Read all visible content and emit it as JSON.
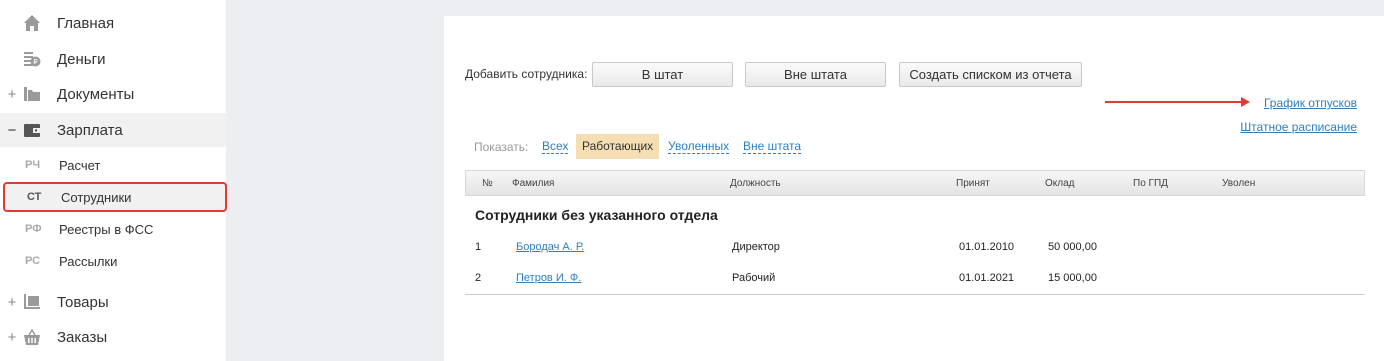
{
  "sidebar": {
    "items": [
      {
        "label": "Главная",
        "icon": "home-icon"
      },
      {
        "label": "Деньги",
        "icon": "money-icon"
      },
      {
        "label": "Документы",
        "icon": "folder-icon",
        "toggle": "+"
      },
      {
        "label": "Зарплата",
        "icon": "wallet-icon",
        "toggle": "−"
      },
      {
        "label": "Товары",
        "icon": "cart-icon",
        "toggle": "+"
      },
      {
        "label": "Заказы",
        "icon": "basket-icon",
        "toggle": "+"
      }
    ],
    "subitems": [
      {
        "abbr": "РЧ",
        "label": "Расчет"
      },
      {
        "abbr": "СТ",
        "label": "Сотрудники"
      },
      {
        "abbr": "РФ",
        "label": "Реестры в ФСС"
      },
      {
        "abbr": "РС",
        "label": "Рассылки"
      }
    ]
  },
  "toolbar": {
    "add_label": "Добавить сотрудника:",
    "in_staff": "В штат",
    "out_staff": "Вне штата",
    "from_report": "Создать списком из отчета"
  },
  "links": {
    "vacation_schedule": "График отпусков",
    "staff_schedule": "Штатное расписание"
  },
  "filters": {
    "label": "Показать:",
    "options": [
      "Всех",
      "Работающих",
      "Уволенных",
      "Вне штата"
    ],
    "selected": "Работающих"
  },
  "table": {
    "headers": [
      "№",
      "Фамилия",
      "Должность",
      "Принят",
      "Оклад",
      "По ГПД",
      "Уволен"
    ],
    "group_title": "Сотрудники без указанного отдела",
    "rows": [
      {
        "num": "1",
        "name": "Бородач А. Р.",
        "position": "Директор",
        "hired": "01.01.2010",
        "salary": "50 000,00"
      },
      {
        "num": "2",
        "name": "Петров И. Ф.",
        "position": "Рабочий",
        "hired": "01.01.2021",
        "salary": "15 000,00"
      }
    ]
  },
  "colors": {
    "accent_link": "#2e7fc2",
    "highlight_red": "#e03c31",
    "active_filter": "#f5deb3"
  }
}
